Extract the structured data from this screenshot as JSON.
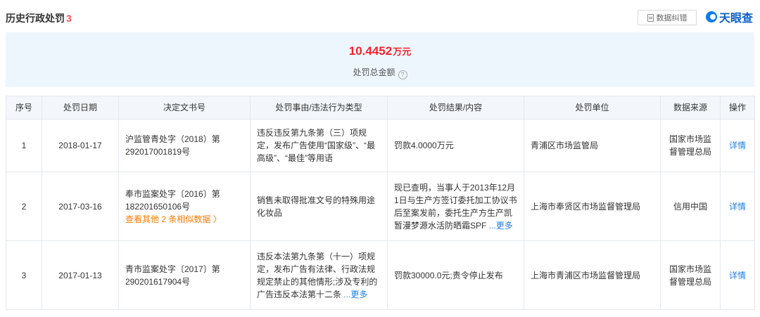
{
  "header": {
    "title": "历史行政处罚",
    "count": "3",
    "correct_label": "数据纠错",
    "logo_text": "天眼查"
  },
  "summary": {
    "amount": "10.4452",
    "unit": "万元",
    "label": "处罚总金额",
    "help_glyph": "?"
  },
  "table": {
    "columns": [
      "序号",
      "处罚日期",
      "决定文书号",
      "处罚事由/违法行为类型",
      "处罚结果/内容",
      "处罚单位",
      "数据来源",
      "操作"
    ],
    "rows": [
      {
        "index": "1",
        "date": "2018-01-17",
        "doc_no": "沪监管青处字（2018）第292017001819号",
        "similar": "",
        "reason": "违反违反第九条第（三）项规定，发布广告使用“国家级”、“最高级”、“最佳”等用语",
        "reason_more": "",
        "result": "罚款4.0000万元",
        "result_more": "",
        "unit": "青浦区市场监管局",
        "source": "国家市场监督管理总局",
        "action": "详情"
      },
      {
        "index": "2",
        "date": "2017-03-16",
        "doc_no": "奉市监案处字〔2016〕第182201650106号",
        "similar": "查看其他 2 条相似数据 〉",
        "reason": "销售未取得批准文号的特殊用途化妆品",
        "reason_more": "",
        "result": "现已查明，当事人于2013年12月1日与生产方签订委托加工协议书后至案发前，委托生产方生产凯暂漫梦源水活防晒霜SPF",
        "result_more": "...更多",
        "unit": "上海市奉贤区市场监督管理局",
        "source": "信用中国",
        "action": "详情"
      },
      {
        "index": "3",
        "date": "2017-01-13",
        "doc_no": "青市监案处字〔2017〕第290201617904号",
        "similar": "",
        "reason": "违反本法第九条第（十一）项规定，发布广告有法律、行政法规规定禁止的其他情形;涉及专利的广告违反本法第十二条",
        "reason_more": "...更多",
        "result": "罚款30000.0元;责令停止发布",
        "result_more": "",
        "unit": "上海市青浦区市场监督管理局",
        "source": "国家市场监督管理总局",
        "action": "详情"
      }
    ]
  }
}
